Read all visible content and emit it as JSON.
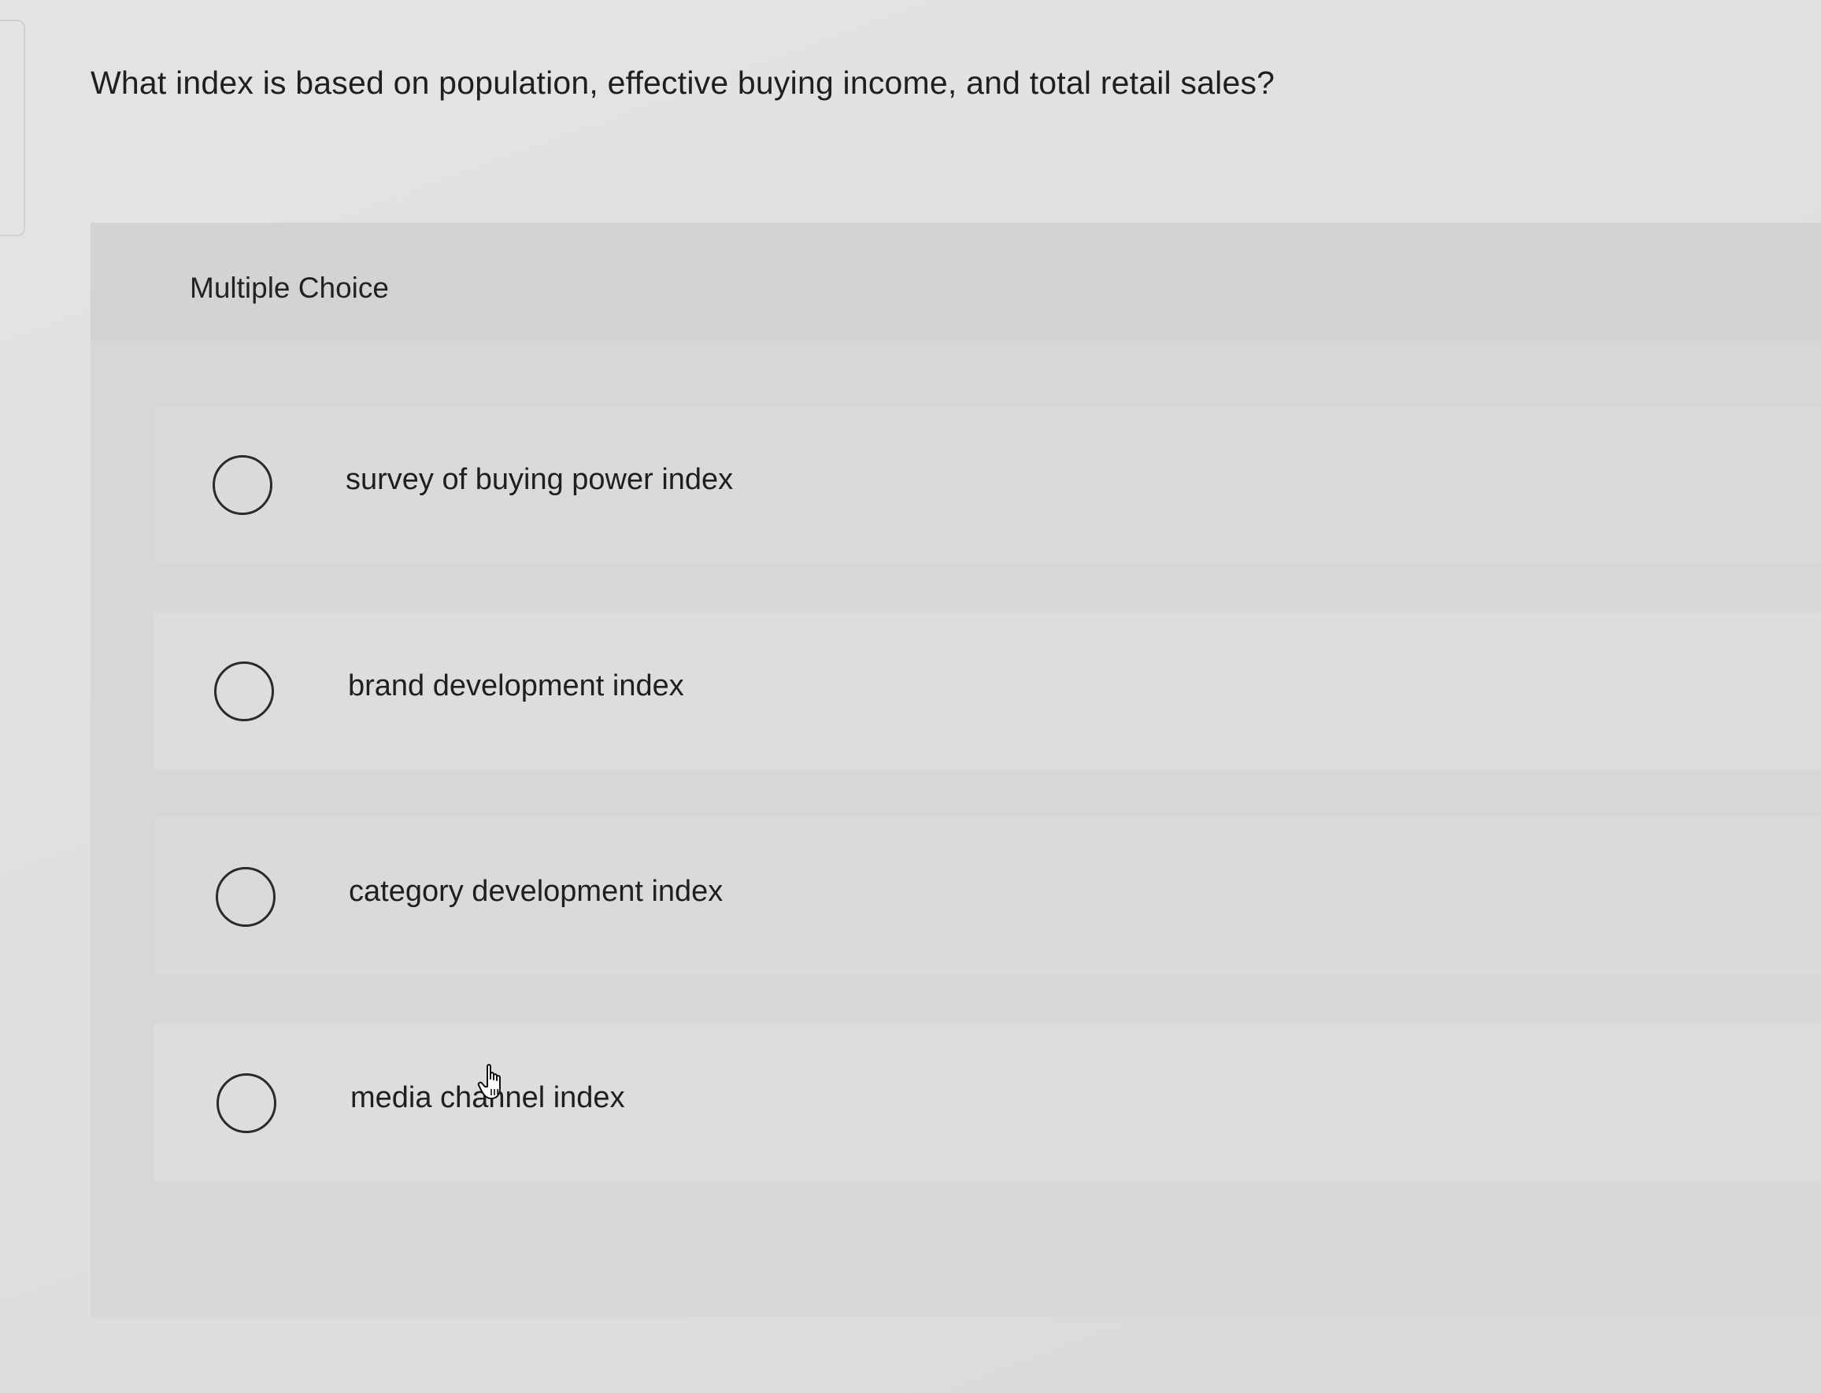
{
  "question": {
    "text": "What index is based on population, effective buying income, and total retail sales?"
  },
  "section": {
    "label": "Multiple Choice"
  },
  "options": [
    {
      "label": "survey of buying power index",
      "selected": false
    },
    {
      "label": "brand development index",
      "selected": false
    },
    {
      "label": "category development index",
      "selected": false
    },
    {
      "label": "media channel index",
      "selected": false
    }
  ],
  "icons": {
    "radio": "radio-unchecked-icon",
    "cursor": "hand-pointer-cursor-icon"
  }
}
